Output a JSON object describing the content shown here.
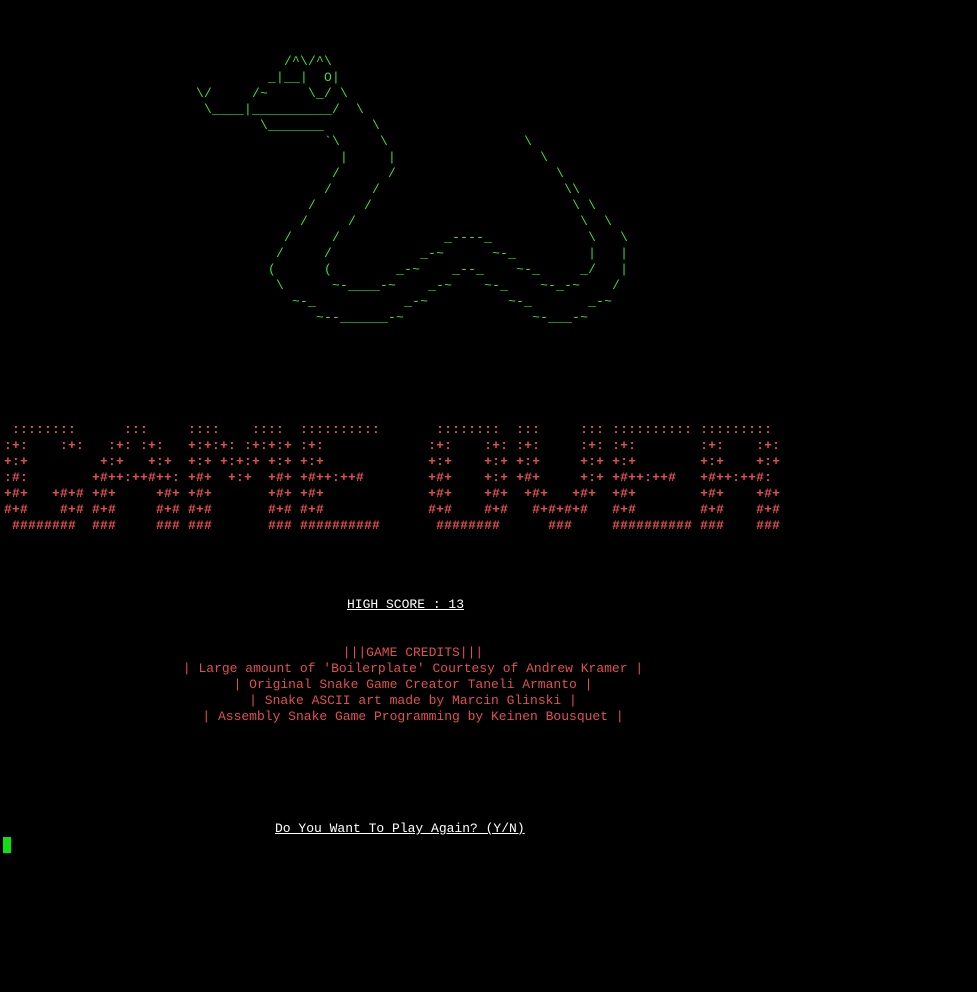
{
  "colors": {
    "background": "#000000",
    "snake": "#3cdc3c",
    "banner": "#e05050",
    "text": "#ffffff",
    "credits": "#e05050",
    "cursor": "#10e010"
  },
  "snake_ascii": [
    "                                   /^\\/^\\",
    "                                 _|__|  O|",
    "                        \\/     /~     \\_/ \\",
    "                         \\____|__________/  \\",
    "                                \\_______      \\",
    "                                        `\\     \\                 \\",
    "                                          |     |                  \\",
    "                                         /      /                    \\",
    "                                        /     /                       \\\\",
    "                                      /      /                         \\ \\",
    "                                     /     /                            \\  \\",
    "                                   /     /             _----_            \\   \\",
    "                                  /     /           _-~      ~-_         |   |",
    "                                 (      (        _-~    _--_    ~-_     _/   |",
    "                                  \\      ~-____-~    _-~    ~-_    ~-_-~    /",
    "                                    ~-_           _-~          ~-_       _-~",
    "                                       ~--______-~                ~-___-~"
  ],
  "game_over_banner": [
    " ::::::::      :::     ::::    ::::  ::::::::::       ::::::::  :::     ::: :::::::::: ::::::::: ",
    ":+:    :+:   :+: :+:   +:+:+: :+:+:+ :+:             :+:    :+: :+:     :+: :+:        :+:    :+: ",
    "+:+         +:+   +:+  +:+ +:+:+ +:+ +:+             +:+    +:+ +:+     +:+ +:+        +:+    +:+ ",
    ":#:        +#++:++#++: +#+  +:+  +#+ +#++:++#        +#+    +:+ +#+     +:+ +#++:++#   +#++:++#:  ",
    "+#+   +#+# +#+     +#+ +#+       +#+ +#+             +#+    +#+  +#+   +#+  +#+        +#+    +#+ ",
    "#+#    #+# #+#     #+# #+#       #+# #+#             #+#    #+#   #+#+#+#   #+#        #+#    #+# ",
    " ########  ###     ### ###       ### ##########       ########      ###     ########## ###    ### "
  ],
  "high_score_text": "HIGH SCORE : 13",
  "credits": {
    "title": "|||GAME CREDITS|||",
    "lines": [
      "| Large amount of 'Boilerplate' Courtesy of Andrew Kramer |",
      "| Original Snake Game Creator Taneli Armanto |",
      "| Snake ASCII art made by Marcin Glinski |",
      "| Assembly Snake Game Programming by Keinen Bousquet |"
    ]
  },
  "prompt_text": "Do You Want To Play Again? (Y/N)"
}
